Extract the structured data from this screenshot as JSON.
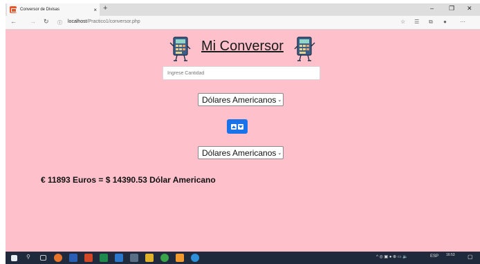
{
  "browser": {
    "tab_title": "Conversor de Divisas",
    "tab_close": "×",
    "new_tab": "+",
    "url_host": "localhost",
    "url_path": "/Practico1/conversor.php",
    "window_min": "–",
    "window_max": "❐",
    "window_close": "✕"
  },
  "app": {
    "title": "Mi Conversor",
    "amount_placeholder": "Ingrese Cantidad",
    "from_currency": "Dólares Americanos",
    "to_currency": "Dólares Americanos",
    "result": "€ 11893 Euros = $ 14390.53 Dólar Americano"
  },
  "taskbar": {
    "lang": "ESP",
    "time": "16:53"
  },
  "colors": {
    "page_bg": "#fec0cb",
    "button_blue": "#1a73e8",
    "taskbar": "#1f2a3c"
  }
}
